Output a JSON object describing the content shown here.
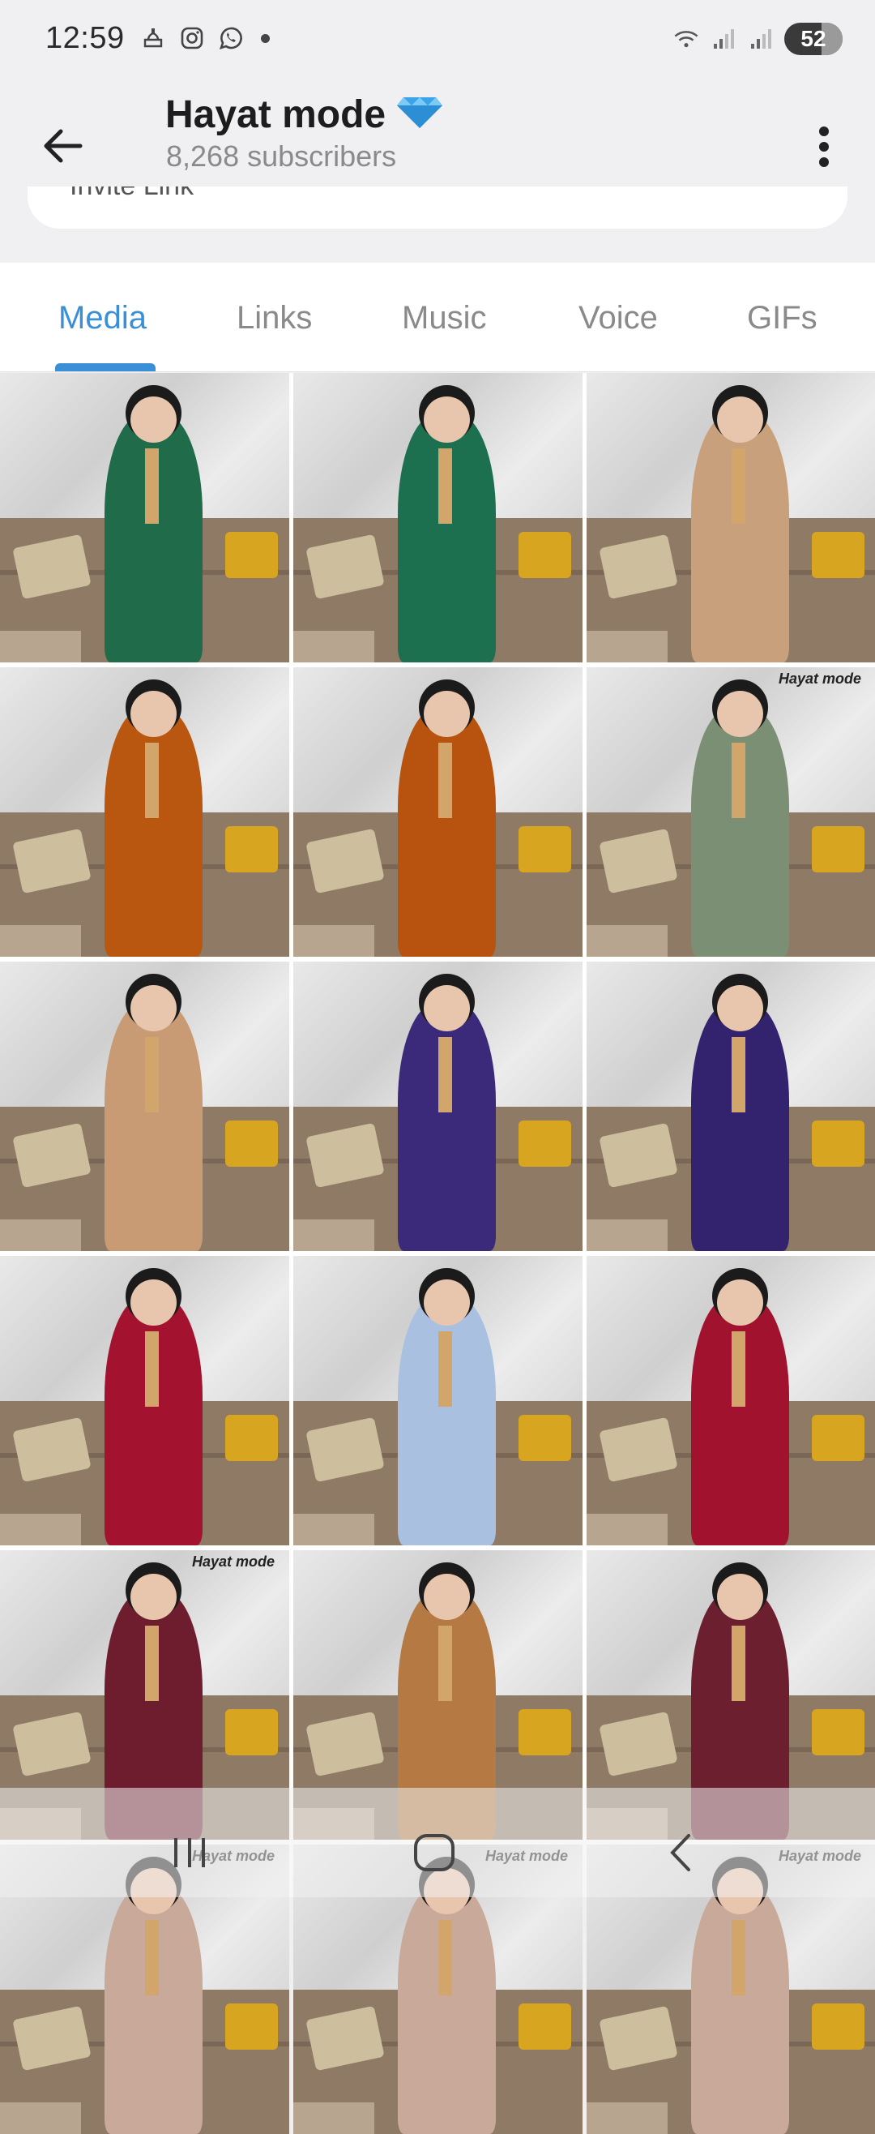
{
  "status_bar": {
    "time": "12:59",
    "left_icons": [
      "mosque-icon",
      "instagram-icon",
      "whatsapp-icon",
      "notification-dot"
    ],
    "right_icons": [
      "wifi-icon",
      "signal-icon",
      "signal-icon"
    ],
    "battery_level": "52"
  },
  "header": {
    "title": "Hayat mode",
    "title_emoji": "💎",
    "subtitle": "8,268 subscribers",
    "back_icon": "arrow-left-icon",
    "menu_icon": "more-vertical-icon"
  },
  "info_card": {
    "partial_text": "Invite Link"
  },
  "tabs": {
    "items": [
      "Media",
      "Links",
      "Music",
      "Voice",
      "GIFs"
    ],
    "active": "Media",
    "accent_color": "#3a8fd6"
  },
  "media": {
    "watermark": "Hayat mode",
    "tiles": [
      {
        "dress_color": "#1f6b4a",
        "watermark": ""
      },
      {
        "dress_color": "#1c7050",
        "watermark": ""
      },
      {
        "dress_color": "#c8a07c",
        "watermark": ""
      },
      {
        "dress_color": "#b9560f",
        "watermark": ""
      },
      {
        "dress_color": "#b8520f",
        "watermark": ""
      },
      {
        "dress_color": "#7a8f74",
        "watermark": "Hayat mode"
      },
      {
        "dress_color": "#c99b74",
        "watermark": ""
      },
      {
        "dress_color": "#3b2a7a",
        "watermark": ""
      },
      {
        "dress_color": "#33236e",
        "watermark": ""
      },
      {
        "dress_color": "#a3132f",
        "watermark": ""
      },
      {
        "dress_color": "#a9c0e0",
        "watermark": ""
      },
      {
        "dress_color": "#a0122d",
        "watermark": ""
      },
      {
        "dress_color": "#6e1d2e",
        "watermark": "Hayat mode"
      },
      {
        "dress_color": "#b57a44",
        "watermark": ""
      },
      {
        "dress_color": "#6b1f2f",
        "watermark": ""
      },
      {
        "dress_color": "#c9a99a",
        "watermark": "Hayat mode"
      },
      {
        "dress_color": "#c9a99a",
        "watermark": "Hayat mode"
      },
      {
        "dress_color": "#c9a99a",
        "watermark": "Hayat mode"
      }
    ]
  },
  "nav_bar": {
    "buttons": [
      "recent-apps-icon",
      "home-icon",
      "back-icon"
    ]
  }
}
